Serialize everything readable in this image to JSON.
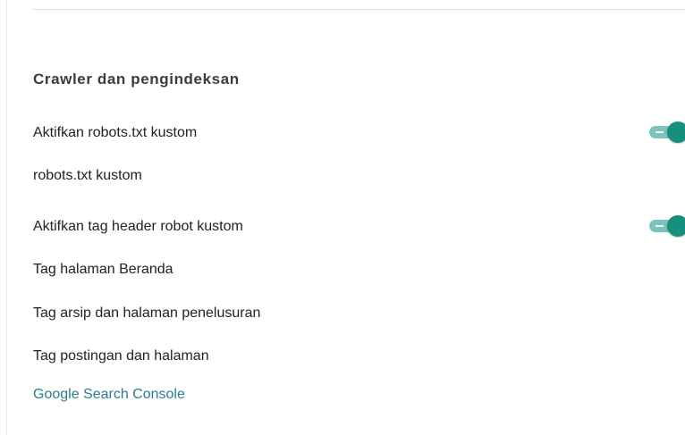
{
  "section": {
    "title": "Crawler dan pengindeksan"
  },
  "settings": {
    "enable_custom_robots_txt": {
      "label": "Aktifkan robots.txt kustom",
      "enabled": true
    },
    "custom_robots_txt": {
      "label": "robots.txt kustom"
    },
    "enable_custom_robot_header_tags": {
      "label": "Aktifkan tag header robot kustom",
      "enabled": true
    },
    "home_page_tags": {
      "label": "Tag halaman Beranda"
    },
    "archive_search_tags": {
      "label": "Tag arsip dan halaman penelusuran"
    },
    "post_page_tags": {
      "label": "Tag postingan dan halaman"
    },
    "search_console_link": {
      "label": "Google Search Console"
    }
  },
  "colors": {
    "accent": "#168f7d",
    "toggle_track": "#7bc4bd",
    "link": "#2a7e8c"
  }
}
